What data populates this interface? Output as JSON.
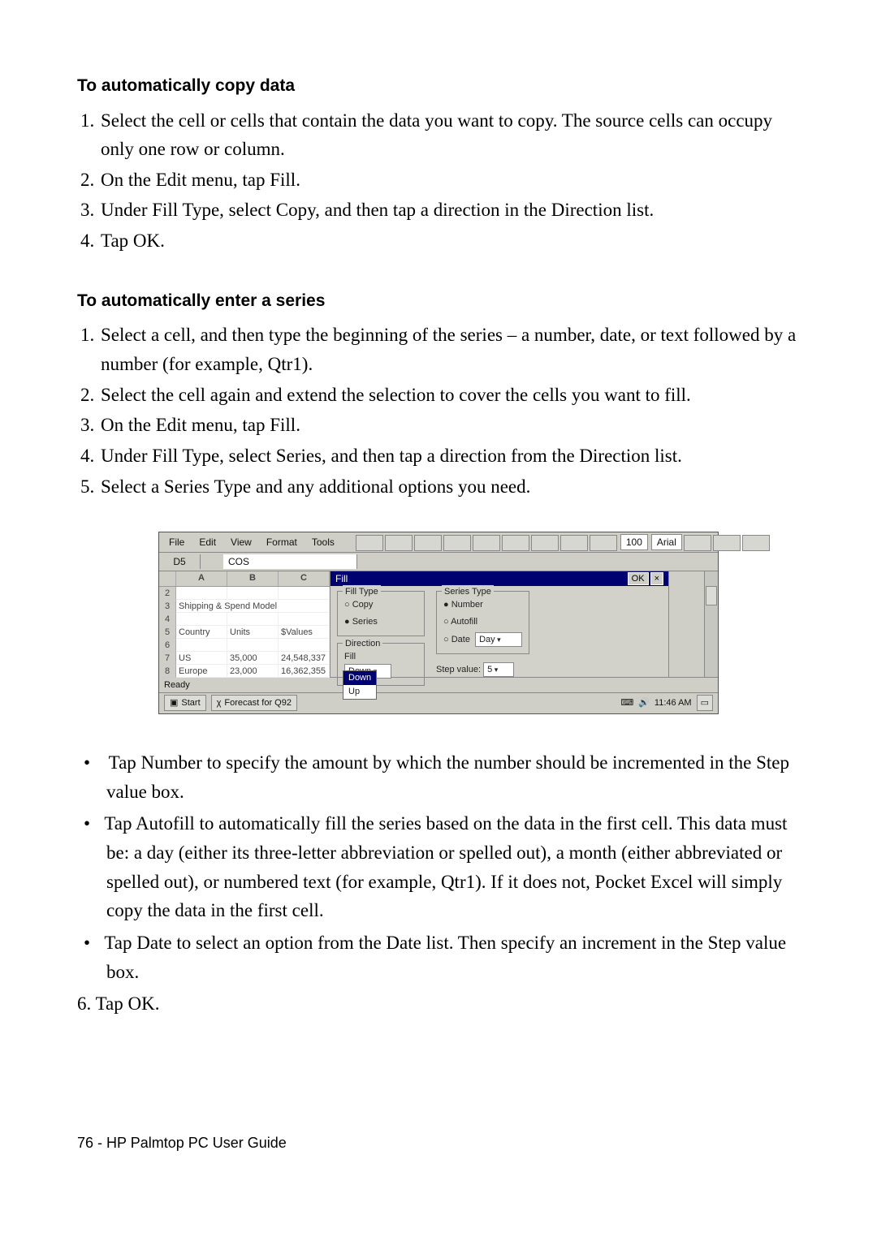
{
  "section1": {
    "title": "To automatically copy data",
    "steps": [
      "Select the cell or cells that contain the data you want to copy. The source cells can occupy only one row or column.",
      "On the Edit menu, tap Fill.",
      "Under Fill Type, select Copy, and then tap a direction in the Direction list.",
      "Tap OK."
    ]
  },
  "section2": {
    "title": "To automatically enter a series",
    "steps_upper": [
      "Select a cell, and then type the beginning of the series – a number, date, or text followed by a number (for example, Qtr1).",
      "Select the cell again and extend the selection to cover the cells you want to fill.",
      "On the Edit menu, tap Fill.",
      "Under Fill Type, select Series, and then tap a direction from the Direction list.",
      "Select a Series Type and any additional options you need."
    ],
    "bullets": [
      " Tap Number to specify the amount by which the number should be incremented in the Step value box.",
      "Tap Autofill to automatically fill the series based on the data in the first cell. This data must be: a day (either its three-letter abbreviation or spelled out), a month (either abbreviated or spelled out), or numbered text (for example, Qtr1). If it does not, Pocket Excel will simply copy the data in the first cell.",
      "Tap Date to select an option from the Date list. Then specify an increment in the Step value box."
    ],
    "step6": "6. Tap OK."
  },
  "illustration": {
    "menus": [
      "File",
      "Edit",
      "View",
      "Format",
      "Tools"
    ],
    "zoom": "100",
    "font": "Arial",
    "cellRef": "D5",
    "formula": "COS",
    "cols": [
      "A",
      "B",
      "C"
    ],
    "rows": {
      "2": [
        "",
        "",
        ""
      ],
      "3": [
        "Shipping & Spend Model",
        "",
        ""
      ],
      "4": [
        "",
        "",
        ""
      ],
      "5": [
        "Country",
        "Units",
        "$Values"
      ],
      "6": [
        "",
        "",
        ""
      ],
      "7": [
        "US",
        "35,000",
        "24,548,337"
      ],
      "8": [
        "Europe",
        "23,000",
        "16,362,355"
      ]
    },
    "dialog": {
      "title": "Fill",
      "okLabel": "OK",
      "closeLabel": "×",
      "fillType": {
        "label": "Fill Type",
        "options": [
          "Copy",
          "Series"
        ],
        "selected": "Series"
      },
      "direction": {
        "label": "Direction",
        "fill": "Fill",
        "selected": "Down",
        "list": [
          "Down",
          "Up"
        ]
      },
      "seriesType": {
        "label": "Series Type",
        "options": [
          "Number",
          "Autofill",
          "Date"
        ],
        "selected": "Number"
      },
      "dateList": {
        "label": "Day",
        "value": "Day"
      },
      "stepValue": {
        "label": "Step value:",
        "value": "5"
      }
    },
    "status": "Ready",
    "taskbar": {
      "start": "Start",
      "taskLabel": "Forecast for Q92",
      "time": "11:46 AM"
    }
  },
  "footer": "76 - HP Palmtop PC User Guide"
}
